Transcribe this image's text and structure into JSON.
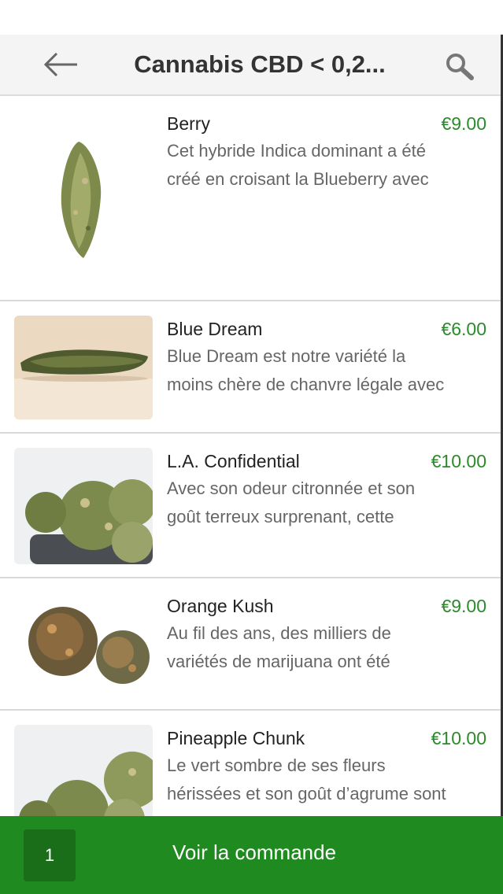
{
  "header": {
    "title": "Cannabis CBD < 0,2...",
    "back_icon": "arrow-left-icon",
    "search_icon": "search-icon"
  },
  "products": [
    {
      "name": "Berry",
      "price": "€9.00",
      "desc_line1": "Cet hybride Indica dominant a été",
      "desc_line2": "créé en croisant la Blueberry avec"
    },
    {
      "name": "Blue Dream",
      "price": "€6.00",
      "desc_line1": "Blue Dream est notre variété la",
      "desc_line2": "moins chère de chanvre légale avec"
    },
    {
      "name": "L.A. Confidential",
      "price": "€10.00",
      "desc_line1": "Avec son odeur citronnée et son",
      "desc_line2": "goût terreux surprenant, cette"
    },
    {
      "name": "Orange Kush",
      "price": "€9.00",
      "desc_line1": "Au fil des ans, des milliers de",
      "desc_line2": "variétés de marijuana ont été"
    },
    {
      "name": "Pineapple Chunk",
      "price": "€10.00",
      "desc_line1": "Le vert sombre de ses fleurs",
      "desc_line2": "hérissées et son goût d’agrume sont"
    }
  ],
  "order_bar": {
    "quantity": "1",
    "label": "Voir la commande"
  },
  "colors": {
    "accent_green": "#1f8a1f",
    "price_green": "#2b8a2b"
  }
}
